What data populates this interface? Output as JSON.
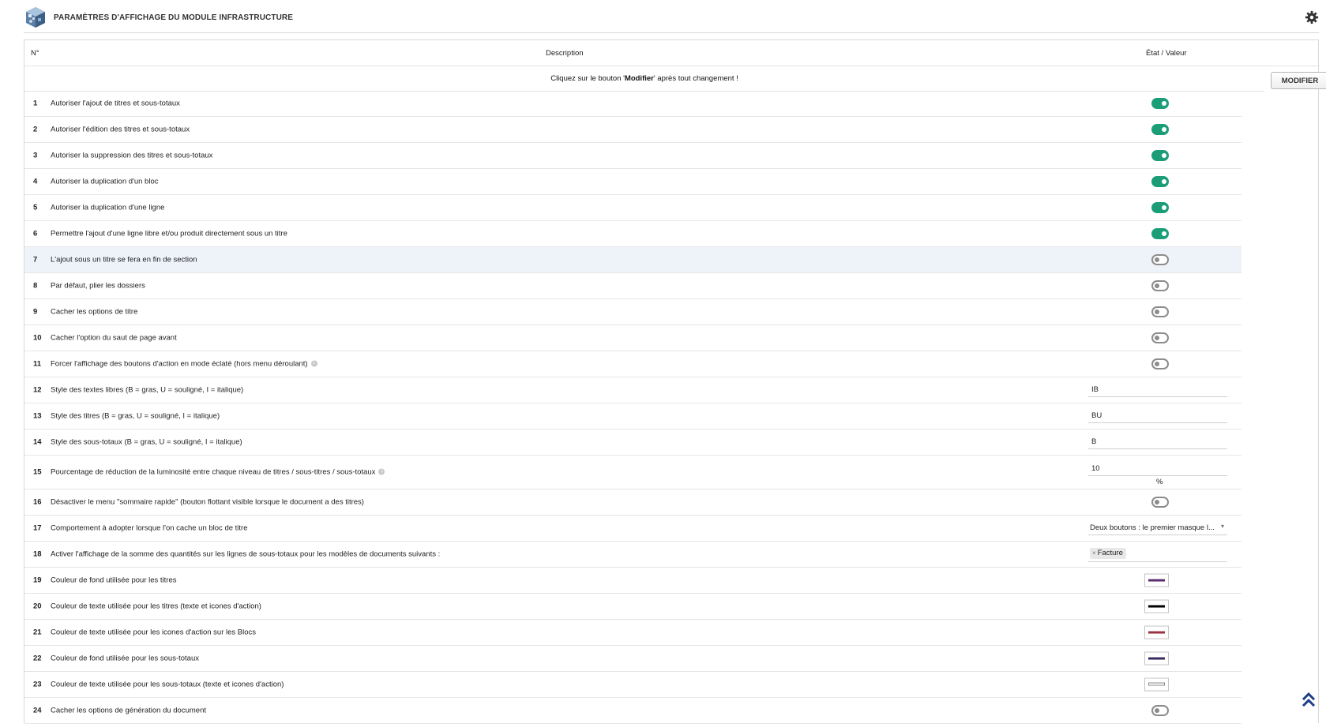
{
  "page": {
    "title": "PARAMÈTRES D'AFFICHAGE DU MODULE INFRASTRUCTURE",
    "logo_icon": "module-cube-icon",
    "settings_icon": "gear-icon",
    "scroll_top_icon": "double-chevron-up-icon"
  },
  "table": {
    "col_num": "N°",
    "col_desc": "Description",
    "col_value": "État / Valeur",
    "notice_prefix": "Cliquez sur le bouton '",
    "notice_bold": "Modifier",
    "notice_suffix": "' après tout changement !",
    "modify_button": "MODIFIER"
  },
  "colors": {
    "toggle_on": "#1b9e77",
    "toggle_off": "#8c8c8c"
  },
  "rows": [
    {
      "num": "1",
      "desc": "Autoriser l'ajout de titres et sous-totaux",
      "type": "toggle",
      "value": true
    },
    {
      "num": "2",
      "desc": "Autoriser l'édition des titres et sous-totaux",
      "type": "toggle",
      "value": true
    },
    {
      "num": "3",
      "desc": "Autoriser la suppression des titres et sous-totaux",
      "type": "toggle",
      "value": true
    },
    {
      "num": "4",
      "desc": "Autoriser la duplication d'un bloc",
      "type": "toggle",
      "value": true
    },
    {
      "num": "5",
      "desc": "Autoriser la duplication d'une ligne",
      "type": "toggle",
      "value": true
    },
    {
      "num": "6",
      "desc": "Permettre l'ajout d'une ligne libre et/ou produit directement sous un titre",
      "type": "toggle",
      "value": true
    },
    {
      "num": "7",
      "desc": "L'ajout sous un titre se fera en fin de section",
      "type": "toggle",
      "value": false
    },
    {
      "num": "8",
      "desc": "Par défaut, plier les dossiers",
      "type": "toggle",
      "value": false
    },
    {
      "num": "9",
      "desc": "Cacher les options de titre",
      "type": "toggle",
      "value": false
    },
    {
      "num": "10",
      "desc": "Cacher l'option du saut de page avant",
      "type": "toggle",
      "value": false
    },
    {
      "num": "11",
      "desc": "Forcer l'affichage des boutons d'action en mode éclaté (hors menu déroulant)",
      "type": "toggle",
      "value": false
    },
    {
      "num": "12",
      "desc": "Style des textes libres (B = gras, U = souligné, I = italique)",
      "type": "text",
      "value": "IB"
    },
    {
      "num": "13",
      "desc": "Style des titres (B = gras, U = souligné, I = italique)",
      "type": "text",
      "value": "BU"
    },
    {
      "num": "14",
      "desc": "Style des sous-totaux (B = gras, U = souligné, I = italique)",
      "type": "text",
      "value": "B"
    },
    {
      "num": "15",
      "desc": "Pourcentage de réduction de la luminosité entre chaque niveau de titres / sous-titres / sous-totaux",
      "type": "text",
      "value": "10",
      "unit": "%"
    },
    {
      "num": "16",
      "desc": "Désactiver le menu \"sommaire rapide\" (bouton flottant visible lorsque le document a des titres)",
      "type": "toggle",
      "value": false
    },
    {
      "num": "17",
      "desc": "Comportement à adopter lorsque l'on cache un bloc de titre",
      "type": "select",
      "value": "Deux boutons : le premier masque l..."
    },
    {
      "num": "18",
      "desc": "Activer l'affichage de la somme des quantités sur les lignes de sous-totaux pour les modèles de documents suivants :",
      "type": "multi",
      "value": "Facture"
    },
    {
      "num": "19",
      "desc": "Couleur de fond utilisée pour les titres",
      "type": "color",
      "value": "#5b2e6e"
    },
    {
      "num": "20",
      "desc": "Couleur de texte utilisée pour les titres (texte et icones d'action)",
      "type": "color",
      "value": "#000000"
    },
    {
      "num": "21",
      "desc": "Couleur de texte utilisée pour les icones d'action sur les Blocs",
      "type": "color",
      "value": "#9b3442"
    },
    {
      "num": "22",
      "desc": "Couleur de fond utilisée pour les sous-totaux",
      "type": "color",
      "value": "#3b2a62"
    },
    {
      "num": "23",
      "desc": "Couleur de texte utilisée pour les sous-totaux (texte et icones d'action)",
      "type": "color",
      "value": "#ffffff"
    },
    {
      "num": "24",
      "desc": "Cacher les options de génération du document",
      "type": "toggle",
      "value": false
    }
  ]
}
